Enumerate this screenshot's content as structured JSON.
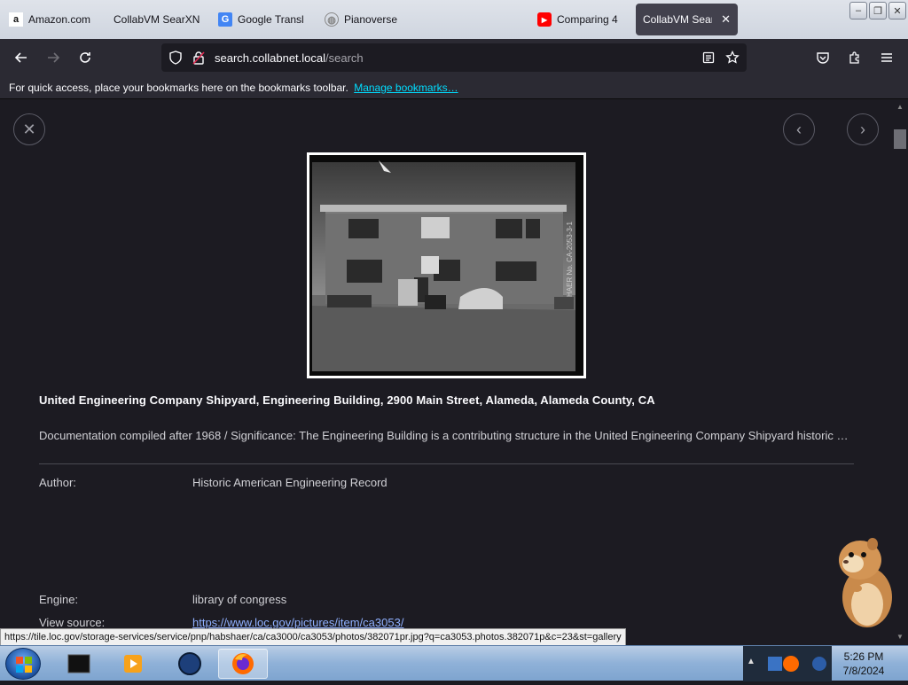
{
  "tabs": [
    {
      "label": "Amazon.com",
      "icon": "amazon-icon",
      "active": false
    },
    {
      "label": "CollabVM SearXN",
      "icon": "collabvm-icon",
      "active": false
    },
    {
      "label": "Google Transl",
      "icon": "google-translate-icon",
      "active": false
    },
    {
      "label": "Pianoverse",
      "icon": "pianoverse-icon",
      "active": false
    },
    {
      "label": "Comparing 4",
      "icon": "youtube-icon",
      "active": false
    },
    {
      "label": "CollabVM Sear",
      "icon": "collabvm-icon",
      "active": true
    }
  ],
  "url": {
    "host": "search.collabnet.local",
    "path": "/search"
  },
  "bookmarks": {
    "message": "For quick access, place your bookmarks here on the bookmarks toolbar.",
    "manage_link": "Manage bookmarks…"
  },
  "result": {
    "title": "United Engineering Company Shipyard, Engineering Building, 2900 Main Street, Alameda, Alameda County, CA",
    "description": "Documentation compiled after 1968 / Significance: The Engineering Building is a contributing structure in the United Engineering Company Shipyard historic …",
    "author_label": "Author:",
    "author_value": "Historic American Engineering Record",
    "engine_label": "Engine:",
    "engine_value": "library of congress",
    "source_label": "View source:",
    "source_value": "https://www.loc.gov/pictures/item/ca3053/"
  },
  "status_url": "https://tile.loc.gov/storage-services/service/pnp/habshaer/ca/ca3000/ca3053/photos/382071pr.jpg?q=ca3053.photos.382071p&c=23&st=gallery",
  "clock": {
    "time": "5:26 PM",
    "date": "7/8/2024"
  }
}
